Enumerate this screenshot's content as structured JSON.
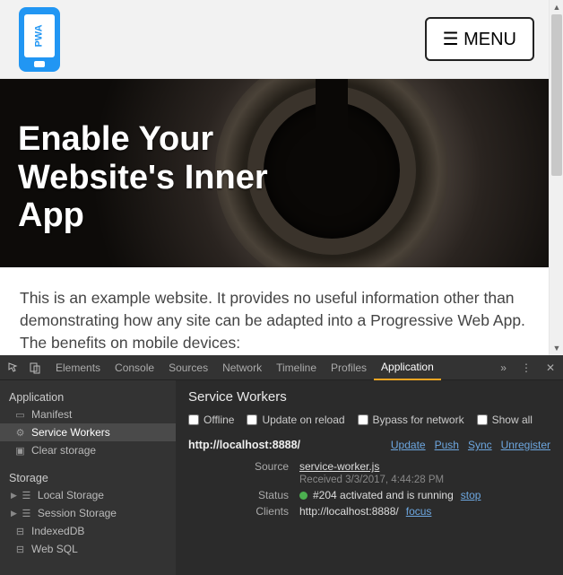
{
  "header": {
    "logo_text": "PWA",
    "menu_label": "☰ MENU"
  },
  "hero": {
    "title_line1": "Enable Your",
    "title_line2": "Website's Inner",
    "title_line3": "App"
  },
  "body": {
    "paragraph": "This is an example website. It provides no useful information other than demonstrating how any site can be adapted into a Progressive Web App. The benefits on mobile devices:"
  },
  "devtools": {
    "tabs": [
      "Elements",
      "Console",
      "Sources",
      "Network",
      "Timeline",
      "Profiles",
      "Application"
    ],
    "active_tab": "Application",
    "sidebar": {
      "section_application": "Application",
      "app_items": [
        {
          "icon": "▭",
          "label": "Manifest"
        },
        {
          "icon": "⚙",
          "label": "Service Workers",
          "selected": true
        },
        {
          "icon": "▣",
          "label": "Clear storage"
        }
      ],
      "section_storage": "Storage",
      "storage_items": [
        {
          "icon": "☰",
          "label": "Local Storage",
          "expandable": true
        },
        {
          "icon": "☰",
          "label": "Session Storage",
          "expandable": true
        },
        {
          "icon": "⊟",
          "label": "IndexedDB"
        },
        {
          "icon": "⊟",
          "label": "Web SQL"
        }
      ]
    },
    "panel": {
      "heading": "Service Workers",
      "checks": [
        {
          "label": "Offline"
        },
        {
          "label": "Update on reload"
        },
        {
          "label": "Bypass for network"
        },
        {
          "label": "Show all"
        }
      ],
      "origin": "http://localhost:8888/",
      "origin_links": [
        "Update",
        "Push",
        "Sync",
        "Unregister"
      ],
      "rows": {
        "source_label": "Source",
        "source_file": "service-worker.js",
        "source_received": "Received 3/3/2017, 4:44:28 PM",
        "status_label": "Status",
        "status_text": "#204 activated and is running",
        "status_action": "stop",
        "clients_label": "Clients",
        "clients_value": "http://localhost:8888/",
        "clients_action": "focus"
      }
    }
  }
}
